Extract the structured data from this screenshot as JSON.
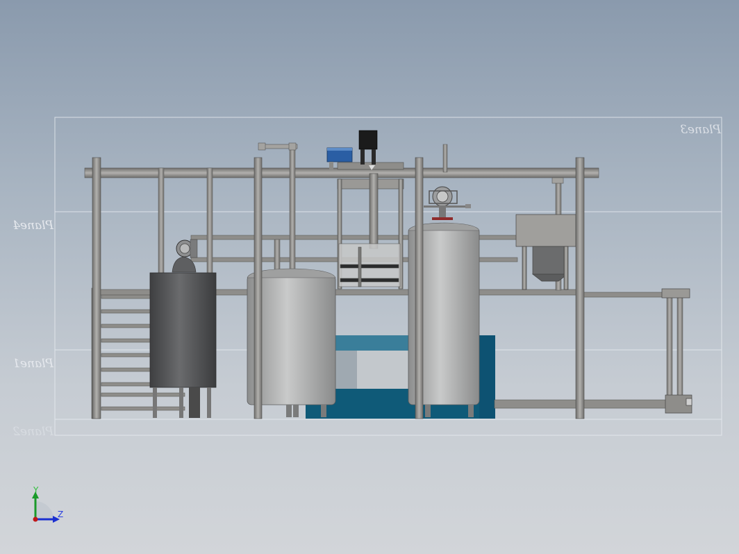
{
  "planes": [
    "Plane3",
    "Plane4",
    "Plane1",
    "Plane2"
  ],
  "triad": {
    "y_label": "Y",
    "z_label": "Z"
  },
  "colors": {
    "steel_light": "#9a9996",
    "steel_dark": "#6f6e6c",
    "tank_dark": "#4e4f51",
    "tank_light": "#b3b4b4",
    "blue_unit": "#0f5a78",
    "motor_blue": "#2a5ea4",
    "motor_black": "#1b1b1b",
    "plane_line": "#e9edf1"
  }
}
